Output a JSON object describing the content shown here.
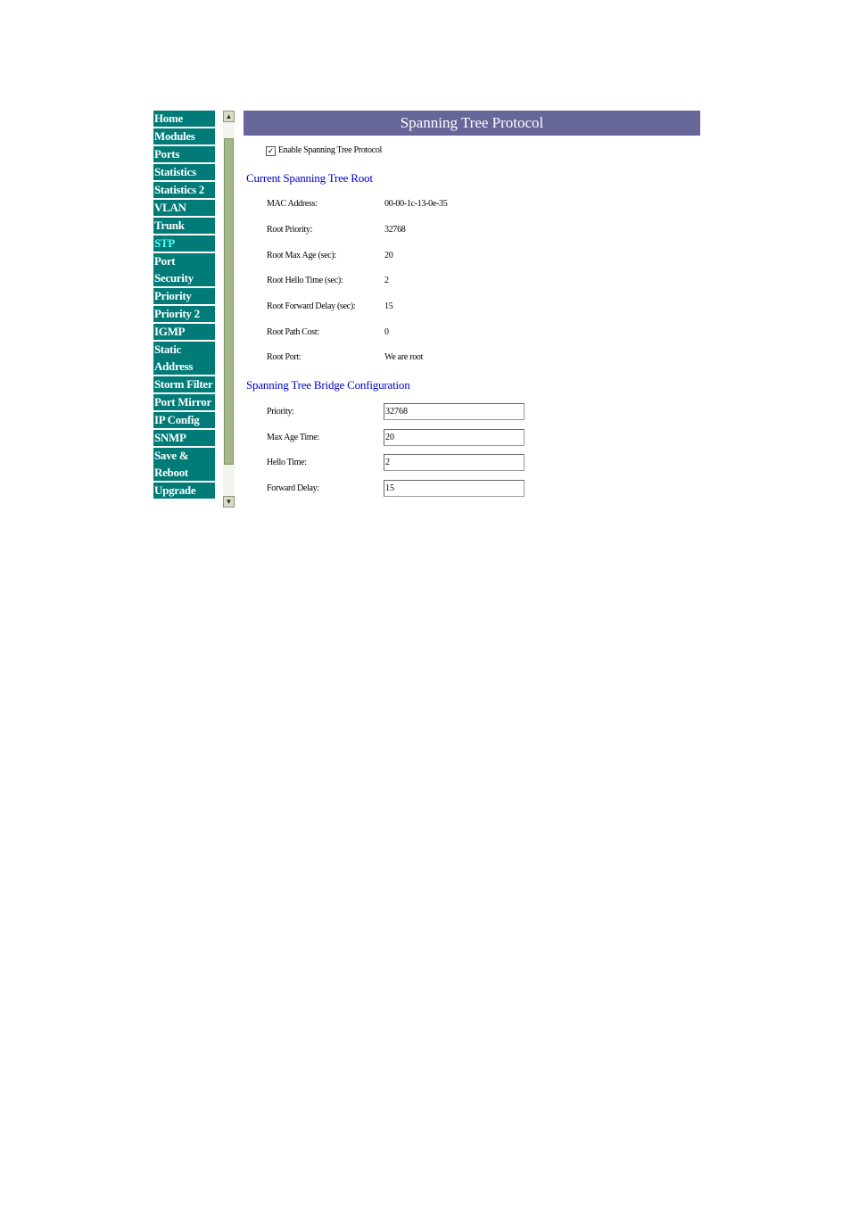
{
  "nav": {
    "items": [
      {
        "label": "Home"
      },
      {
        "label": "Modules"
      },
      {
        "label": "Ports"
      },
      {
        "label": "Statistics"
      },
      {
        "label": "Statistics 2"
      },
      {
        "label": "VLAN"
      },
      {
        "label": "Trunk"
      },
      {
        "label": "STP",
        "active": true
      },
      {
        "label": "Port Security"
      },
      {
        "label": "Priority"
      },
      {
        "label": "Priority 2"
      },
      {
        "label": "IGMP"
      },
      {
        "label": "Static Address"
      },
      {
        "label": "Storm Filter"
      },
      {
        "label": "Port Mirror"
      },
      {
        "label": "IP Config"
      },
      {
        "label": "SNMP"
      },
      {
        "label": "Save & Reboot"
      },
      {
        "label": "Upgrade"
      }
    ]
  },
  "header": {
    "title": "Spanning Tree Protocol"
  },
  "enable": {
    "label": "Enable Spanning Tree Protocol",
    "checked": true
  },
  "root": {
    "title": "Current Spanning Tree Root",
    "rows": [
      {
        "label": "MAC Address:",
        "value": "00-00-1c-13-0e-35"
      },
      {
        "label": "Root Priority:",
        "value": "32768"
      },
      {
        "label": "Root Max Age (sec):",
        "value": "20"
      },
      {
        "label": "Root Hello Time (sec):",
        "value": "2"
      },
      {
        "label": "Root Forward Delay (sec):",
        "value": "15"
      },
      {
        "label": "Root Path Cost:",
        "value": "0"
      },
      {
        "label": "Root Port:",
        "value": "We are root"
      }
    ]
  },
  "bridge": {
    "title": "Spanning Tree Bridge Configuration",
    "fields": [
      {
        "label": "Priority:",
        "value": "32768"
      },
      {
        "label": "Max Age Time:",
        "value": "20"
      },
      {
        "label": "Hello Time:",
        "value": "2"
      },
      {
        "label": "Forward Delay:",
        "value": "15"
      }
    ]
  },
  "colors": {
    "nav_bg": "#007b77",
    "nav_active": "#55ffff",
    "header_bg": "#666699",
    "section": "#0000cc"
  }
}
